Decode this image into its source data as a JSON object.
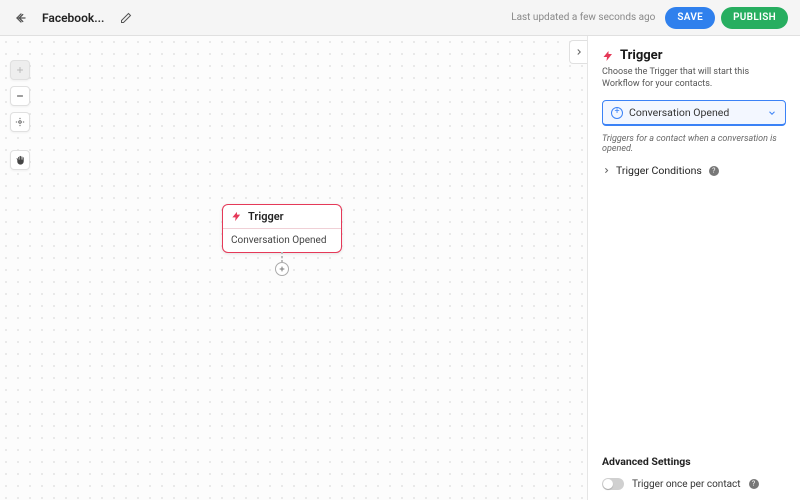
{
  "topbar": {
    "title": "Facebook...",
    "updated": "Last updated a few seconds ago",
    "save_label": "SAVE",
    "publish_label": "PUBLISH"
  },
  "canvas": {
    "node": {
      "head": "Trigger",
      "body": "Conversation Opened"
    }
  },
  "panel": {
    "title": "Trigger",
    "subtitle": "Choose the Trigger that will start this Workflow for your contacts.",
    "selected_trigger": "Conversation Opened",
    "trigger_description": "Triggers for a contact when a conversation is opened.",
    "conditions_label": "Trigger Conditions",
    "advanced_label": "Advanced Settings",
    "toggle_label": "Trigger once per contact"
  }
}
